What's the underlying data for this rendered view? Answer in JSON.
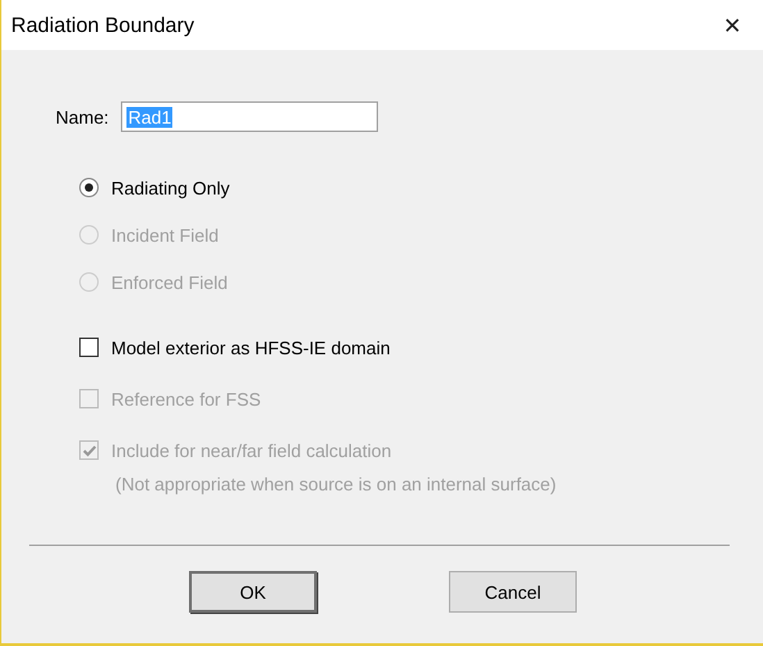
{
  "window": {
    "title": "Radiation Boundary",
    "close": "✕"
  },
  "name_field": {
    "label": "Name:",
    "value": "Rad1"
  },
  "radios": [
    {
      "label": "Radiating Only",
      "selected": true,
      "disabled": false
    },
    {
      "label": "Incident Field",
      "selected": false,
      "disabled": true
    },
    {
      "label": "Enforced Field",
      "selected": false,
      "disabled": true
    }
  ],
  "checkboxes": [
    {
      "label": "Model exterior as HFSS-IE domain",
      "checked": false,
      "disabled": false
    },
    {
      "label": "Reference for FSS",
      "checked": false,
      "disabled": true
    },
    {
      "label": "Include for near/far field calculation",
      "checked": true,
      "disabled": true,
      "note": "(Not appropriate when source is on an internal surface)"
    }
  ],
  "buttons": [
    {
      "label": "OK",
      "default": true
    },
    {
      "label": "Cancel",
      "default": false
    }
  ]
}
